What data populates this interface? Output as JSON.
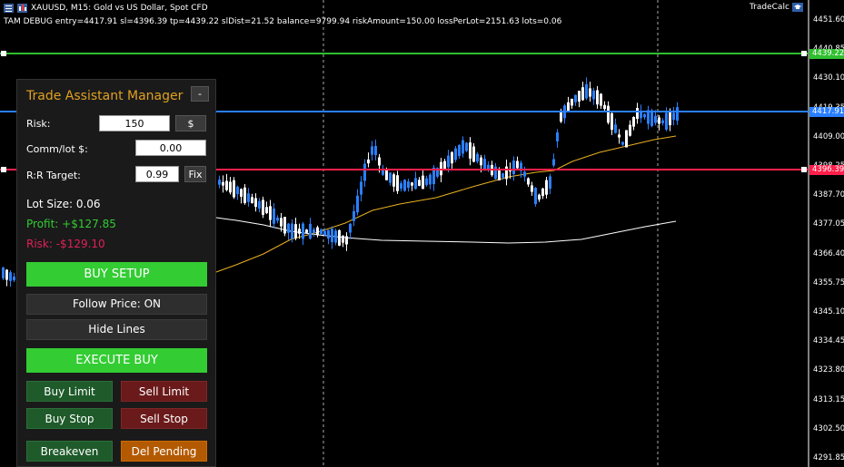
{
  "header": {
    "symbol_line": "XAUUSD, M15:  Gold vs US Dollar, Spot CFD",
    "debug_line": "TAM DEBUG  entry=4417.91  sl=4396.39  tp=4439.22  slDist=21.52  balance=9799.94  riskAmount=150.00  lossPerLot=2151.63  lots=0.06"
  },
  "tradecalc_label": "TradeCalc",
  "price_axis": {
    "ticks": [
      "4451.60",
      "4440.85",
      "4430.10",
      "4419.35",
      "4409.00",
      "4398.25",
      "4387.70",
      "4377.05",
      "4366.40",
      "4355.75",
      "4345.10",
      "4334.45",
      "4323.80",
      "4313.15",
      "4302.50",
      "4291.85"
    ],
    "tp_tag": "4439.22",
    "entry_tag": "4417.91",
    "sl_tag": "4396.39"
  },
  "colors": {
    "tp_line": "#2fbf2f",
    "entry_line": "#2a7fff",
    "sl_line": "#ff1f4a",
    "bull_candle": "#2a7fff",
    "bear_candle": "#ffffff",
    "ma_fast": "#e8b020",
    "ma_slow": "#ffffff"
  },
  "panel": {
    "title": "Trade Assistant Manager",
    "collapse_label": "-",
    "risk_label": "Risk:",
    "risk_value": "150",
    "risk_unit_button": "$",
    "comm_label": "Comm/lot $:",
    "comm_value": "0.00",
    "rr_label": "R:R Target:",
    "rr_value": "0.99",
    "fix_button": "Fix",
    "lot_size": "Lot Size: 0.06",
    "profit": "Profit: +$127.85",
    "risk_amount": "Risk: -$129.10",
    "buy_setup": "BUY SETUP",
    "follow_price": "Follow Price: ON",
    "hide_lines": "Hide Lines",
    "execute_buy": "EXECUTE BUY",
    "buy_limit": "Buy Limit",
    "sell_limit": "Sell Limit",
    "buy_stop": "Buy Stop",
    "sell_stop": "Sell Stop",
    "breakeven": "Breakeven",
    "del_pending": "Del Pending"
  }
}
